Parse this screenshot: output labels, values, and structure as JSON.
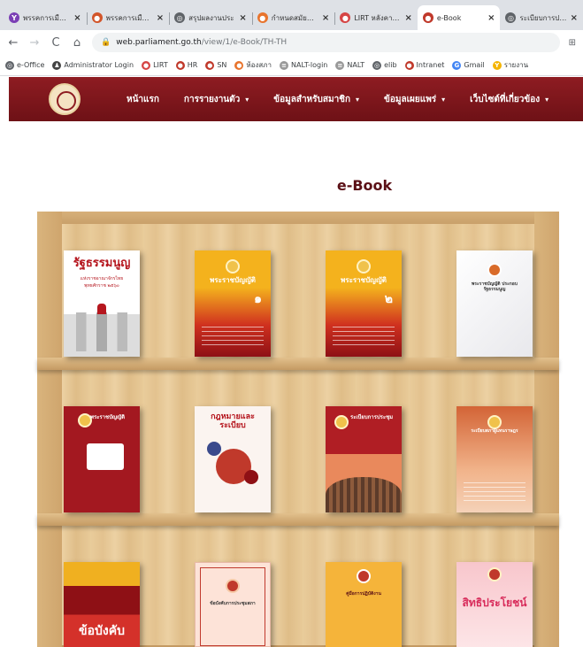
{
  "browser": {
    "tabs": [
      {
        "title": "พรรคการเมืองผู้",
        "color": "#7b3fb5",
        "glyph": "Y"
      },
      {
        "title": "พรรคการเมืองผู้",
        "color": "#d2552a",
        "glyph": "●"
      },
      {
        "title": "สรุปผลงานประ",
        "color": "#5f6368",
        "glyph": "◎"
      },
      {
        "title": "กำหนดสมัยประ",
        "color": "#e8742d",
        "glyph": "●"
      },
      {
        "title": "LIRT หลังคาทอ",
        "color": "#d64545",
        "glyph": "●"
      },
      {
        "title": "e-Book",
        "color": "#c0392b",
        "glyph": "●",
        "active": true
      },
      {
        "title": "ระเบียบการประ",
        "color": "#5f6368",
        "glyph": "◎"
      }
    ],
    "nav": {
      "back": "←",
      "forward": "→",
      "reload": "C",
      "home": "⌂"
    },
    "url": {
      "host": "web.parliament.go.th",
      "path": "/view/1/e-Book/TH-TH"
    },
    "translate": "⊞",
    "bookmarks": [
      {
        "label": "e-Office",
        "color": "#5f6368",
        "glyph": "◎"
      },
      {
        "label": "Administrator Login",
        "color": "#444",
        "glyph": "♟"
      },
      {
        "label": "LIRT",
        "color": "#d64545",
        "glyph": "●"
      },
      {
        "label": "HR",
        "color": "#c0392b",
        "glyph": "●"
      },
      {
        "label": "SN",
        "color": "#c0392b",
        "glyph": "●"
      },
      {
        "label": "ห้องสภา",
        "color": "#e8742d",
        "glyph": "●"
      },
      {
        "label": "NALT-login",
        "color": "#999",
        "glyph": "≡"
      },
      {
        "label": "NALT",
        "color": "#999",
        "glyph": "≡"
      },
      {
        "label": "elib",
        "color": "#5f6368",
        "glyph": "◎"
      },
      {
        "label": "Intranet",
        "color": "#c0392b",
        "glyph": "●"
      },
      {
        "label": "Gmail",
        "color": "#4285f4",
        "glyph": "G"
      },
      {
        "label": "รายงาน",
        "color": "#f4b400",
        "glyph": "Y"
      }
    ]
  },
  "site": {
    "menu": [
      {
        "label": "หน้าแรก",
        "caret": false
      },
      {
        "label": "การรายงานตัว",
        "caret": true
      },
      {
        "label": "ข้อมูลสำหรับสมาชิก",
        "caret": true
      },
      {
        "label": "ข้อมูลเผยแพร่",
        "caret": true
      },
      {
        "label": "เว็บไซต์ที่เกี่ยวข้อง",
        "caret": true
      }
    ],
    "caret_glyph": "▾"
  },
  "page": {
    "title": "e-Book"
  },
  "books": {
    "b1": {
      "title": "รัฐธรรมนูญ",
      "sub": "แห่งราชอาณาจักรไทย พุทธศักราช ๒๕๖๐"
    },
    "b2": {
      "title": "พระราชบัญญัติ",
      "num": "๑"
    },
    "b3": {
      "title": "พระราชบัญญัติ",
      "num": "๒"
    },
    "b4": {
      "title": "พระราชบัญญัติ ประกอบรัฐธรรมนูญ"
    },
    "b5": {
      "title": "พระราชบัญญัติ"
    },
    "b6": {
      "title": "กฎหมายและระเบียบ"
    },
    "b7": {
      "title": "ระเบียบการประชุม"
    },
    "b8": {
      "title": "ระเบียบสภาผู้แทนราษฎร"
    },
    "b9": {
      "title": "ข้อบังคับ"
    },
    "b10": {
      "title": "ข้อบังคับการประชุมสภา"
    },
    "b11": {
      "title": "คู่มือการปฏิบัติงาน"
    },
    "b12": {
      "title": "สิทธิประโยชน์"
    }
  }
}
